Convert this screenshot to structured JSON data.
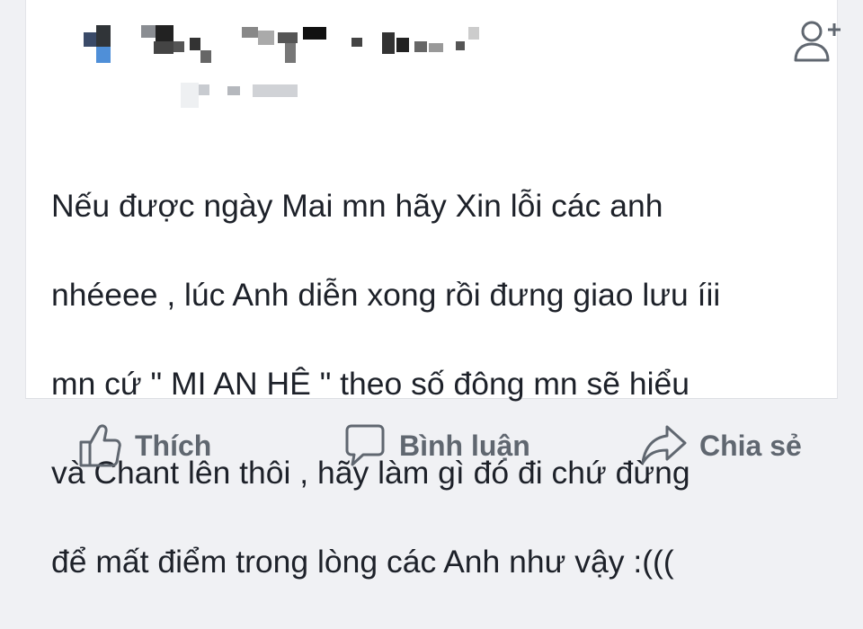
{
  "post": {
    "author_name_pixelated": true,
    "author_meta_pixelated": true,
    "lines": [
      "Nếu được ngày Mai mn hãy Xin lỗi các anh",
      "nhéeee , lúc Anh diễn xong rồi đưng giao lưu íii",
      "mn cứ \" MI AN HÊ \" theo số đông mn sẽ hiểu",
      "và Chant lên thôi , hãy làm gì đó đi chứ đừng",
      "để mất điểm trong lòng các Anh như vậy :((("
    ],
    "add_friend_icon": "add-friend-icon"
  },
  "actions": {
    "like": {
      "label": "Thích",
      "icon": "like-icon"
    },
    "comment": {
      "label": "Bình luận",
      "icon": "comment-icon"
    },
    "share": {
      "label": "Chia sẻ",
      "icon": "share-icon"
    }
  },
  "colors": {
    "text": "#1d2129",
    "action_text": "#606770",
    "icon": "#606770",
    "background": "#f0f1f4",
    "card": "#ffffff"
  }
}
